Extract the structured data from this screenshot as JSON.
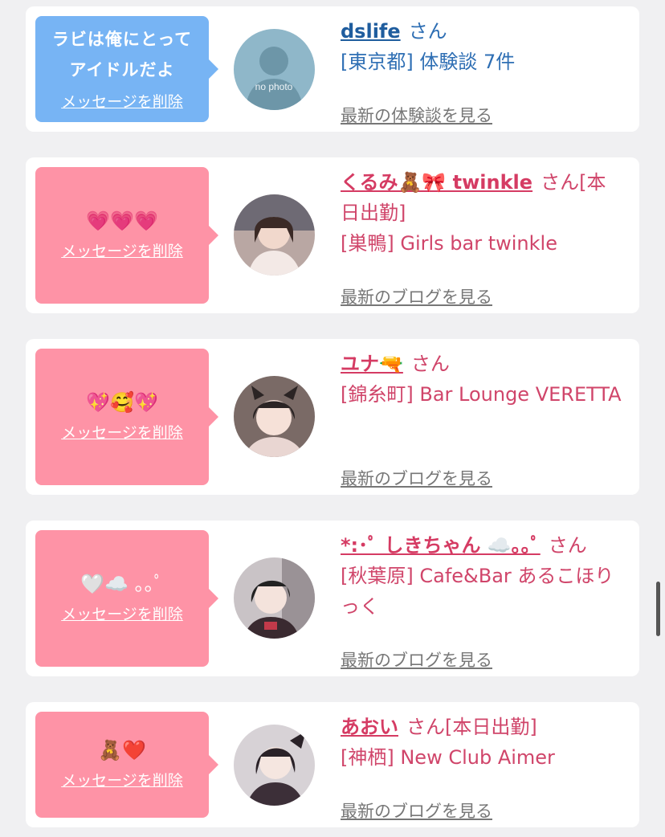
{
  "cards": [
    {
      "message": "ラビは俺にとって\nアイドルだよ",
      "delete_label": "メッセージを削除",
      "name": "dslife",
      "suffix": "さん",
      "meta": "[東京都] 体験談 7件",
      "latest_link": "最新の体験談を見る",
      "avatar_text": "no photo"
    },
    {
      "message": "💗💗💗",
      "delete_label": "メッセージを削除",
      "name": "くるみ🧸🎀 twinkle",
      "suffix": "さん[本日出勤]",
      "meta": "[巣鴨] Girls bar twinkle",
      "latest_link": "最新のブログを見る"
    },
    {
      "message": "💖🥰💖",
      "delete_label": "メッセージを削除",
      "name": "ユナ🔫",
      "suffix": "さん",
      "meta": "[錦糸町] Bar Lounge VERETTA",
      "latest_link": "最新のブログを見る"
    },
    {
      "message": "🤍☁️ ｡｡ﾟ",
      "delete_label": "メッセージを削除",
      "name": "*:･ﾟ しきちゃん ☁️｡｡ﾟ",
      "suffix": "さん",
      "meta": "[秋葉原] Cafe&Bar あるこほりっく",
      "latest_link": "最新のブログを見る"
    },
    {
      "message": "🧸❤️",
      "delete_label": "メッセージを削除",
      "name": "あおい",
      "suffix": "さん[本日出勤]",
      "meta": "[神栖] New Club Aimer",
      "latest_link": "最新のブログを見る"
    }
  ],
  "colors": {
    "blue_bubble": "#77b4f4",
    "pink_bubble": "#fe93a6",
    "blue_text": "#1f5d9e",
    "pink_text": "#d53b63"
  }
}
